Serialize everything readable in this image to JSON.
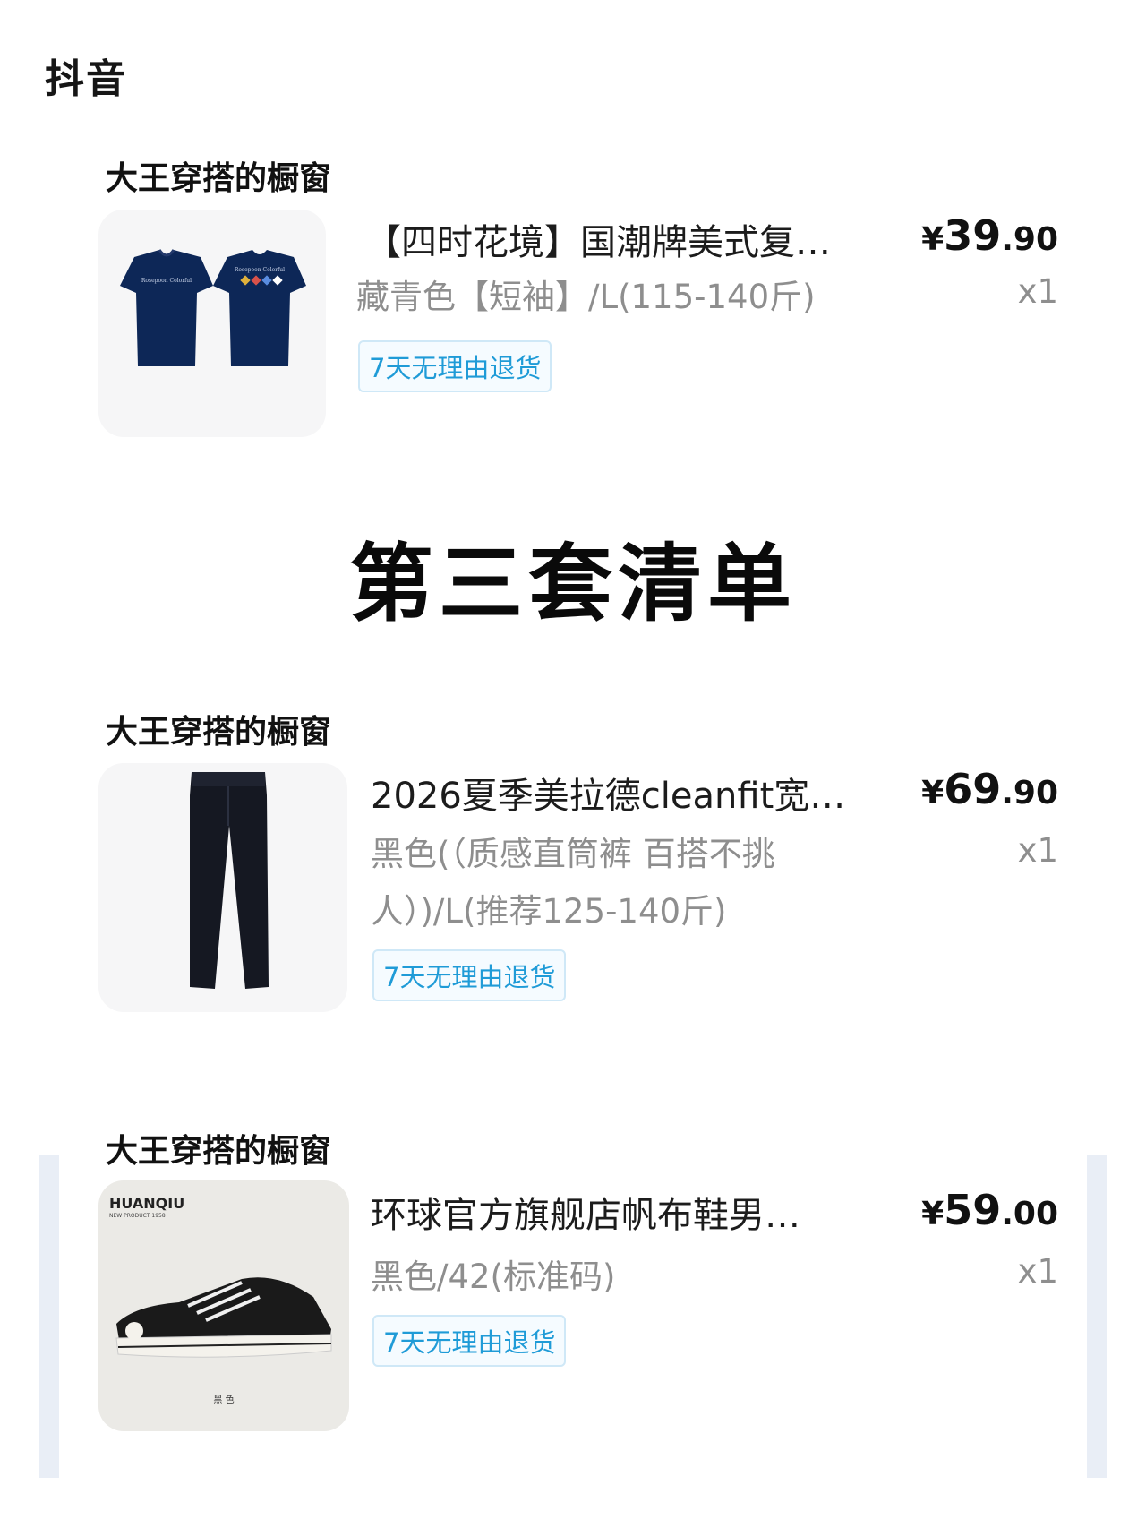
{
  "app": {
    "title": "抖音"
  },
  "section_title": "第三套清单",
  "orders": [
    {
      "shop": "大王穿搭的橱窗",
      "title": "【四时花境】国潮牌美式复…",
      "spec": "藏青色【短袖】/L(115-140斤)",
      "price": {
        "currency": "¥",
        "integer": "39",
        "decimal": ".90"
      },
      "qty": "x1",
      "badge": "7天无理由退货",
      "image": {
        "icon": "tshirt-icon",
        "color": "#0d2757",
        "print_text": "Rosepoon Colorful"
      }
    },
    {
      "shop": "大王穿搭的橱窗",
      "title": "2026夏季美拉德cleanfit宽…",
      "spec": "黑色(（质感直筒裤 百搭不挑人）)/L(推荐125-140斤)",
      "price": {
        "currency": "¥",
        "integer": "69",
        "decimal": ".90"
      },
      "qty": "x1",
      "badge": "7天无理由退货",
      "image": {
        "icon": "pants-icon",
        "color": "#151822"
      }
    },
    {
      "shop": "大王穿搭的橱窗",
      "title": "环球官方旗舰店帆布鞋男…",
      "spec": "黑色/42(标准码)",
      "price": {
        "currency": "¥",
        "integer": "59",
        "decimal": ".00"
      },
      "qty": "x1",
      "badge": "7天无理由退货",
      "image": {
        "icon": "sneaker-icon",
        "color": "#1a1a1a",
        "brand": "HUANQIU",
        "brand_sub": "NEW PRODUCT 1958",
        "caption": "黑 色"
      }
    }
  ]
}
